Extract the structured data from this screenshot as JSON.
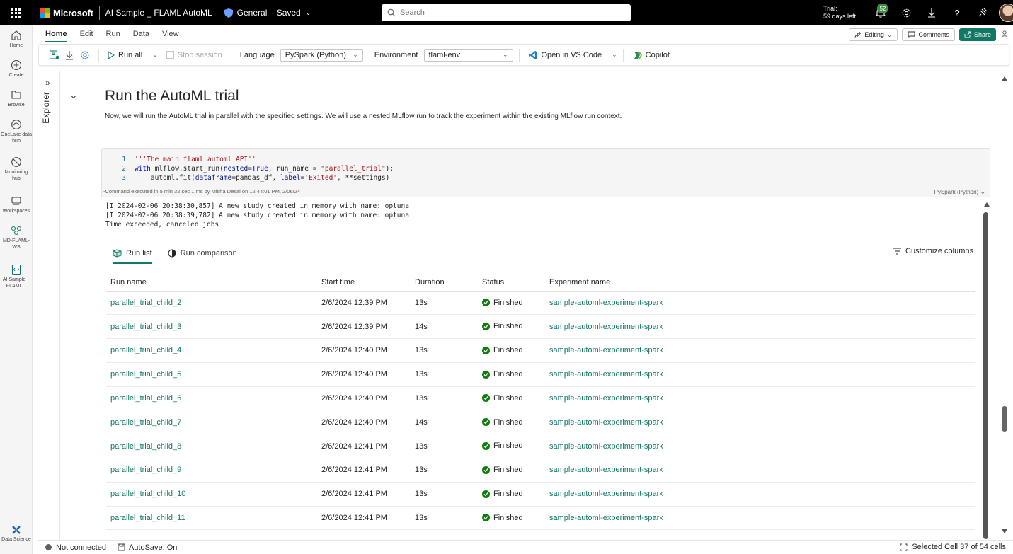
{
  "topbar": {
    "brand": "Microsoft",
    "notebook_name": "AI Sample _ FLAML AutoML",
    "workspace": "General",
    "save_state": "· Saved",
    "search_placeholder": "Search",
    "trial_line1": "Trial:",
    "trial_line2": "59 days left",
    "notification_count": "52"
  },
  "rail": {
    "items": [
      {
        "label": "Home",
        "icon": "home-icon"
      },
      {
        "label": "Create",
        "icon": "plus-circle-icon"
      },
      {
        "label": "Browse",
        "icon": "folder-icon"
      },
      {
        "label": "OneLake data hub",
        "icon": "onelake-icon"
      },
      {
        "label": "Monitoring hub",
        "icon": "monitoring-icon"
      },
      {
        "label": "Workspaces",
        "icon": "workspaces-icon"
      },
      {
        "label": "MD-FLAML-WS",
        "icon": "workspace-group-icon"
      },
      {
        "label": "AI Sample _ FLAML...",
        "icon": "notebook-icon"
      },
      {
        "label": "Data Science",
        "icon": "data-science-icon"
      }
    ]
  },
  "menu": {
    "tabs": [
      "Home",
      "Edit",
      "Run",
      "Data",
      "View"
    ],
    "editing_label": "Editing",
    "comments_label": "Comments",
    "share_label": "Share"
  },
  "toolbar": {
    "run_all": "Run all",
    "stop_session": "Stop session",
    "language_label": "Language",
    "language_value": "PySpark (Python)",
    "environment_label": "Environment",
    "environment_value": "flaml-env",
    "open_vscode": "Open in VS Code",
    "copilot": "Copilot"
  },
  "explorer": {
    "label": "Explorer"
  },
  "cell": {
    "title": "Run the AutoML trial",
    "description": "Now, we will run the AutoML trial in parallel with the specified settings. We will use a nested MLflow run to track the experiment within the existing MLflow run context.",
    "code": {
      "line_numbers": [
        "1",
        "2",
        "3"
      ]
    },
    "exec_info": "-Command executed in 5 min 32 sec 1 ms by Misha Desai on 12:44:01 PM, 2/06/24",
    "language_tag": "PySpark (Python)"
  },
  "output": {
    "log_lines": [
      "[I 2024-02-06 20:38:30,857] A new study created in memory with name: optuna",
      "[I 2024-02-06 20:38:39,782] A new study created in memory with name: optuna",
      "Time exceeded, canceled jobs"
    ],
    "tabs": {
      "run_list": "Run list",
      "run_comparison": "Run comparison"
    },
    "customize_columns": "Customize columns",
    "table": {
      "columns": [
        "Run name",
        "Start time",
        "Duration",
        "Status",
        "Experiment name"
      ],
      "rows": [
        [
          "parallel_trial_child_2",
          "2/6/2024 12:39 PM",
          "13s",
          "Finished",
          "sample-automl-experiment-spark"
        ],
        [
          "parallel_trial_child_3",
          "2/6/2024 12:39 PM",
          "14s",
          "Finished",
          "sample-automl-experiment-spark"
        ],
        [
          "parallel_trial_child_4",
          "2/6/2024 12:40 PM",
          "13s",
          "Finished",
          "sample-automl-experiment-spark"
        ],
        [
          "parallel_trial_child_5",
          "2/6/2024 12:40 PM",
          "13s",
          "Finished",
          "sample-automl-experiment-spark"
        ],
        [
          "parallel_trial_child_6",
          "2/6/2024 12:40 PM",
          "13s",
          "Finished",
          "sample-automl-experiment-spark"
        ],
        [
          "parallel_trial_child_7",
          "2/6/2024 12:40 PM",
          "14s",
          "Finished",
          "sample-automl-experiment-spark"
        ],
        [
          "parallel_trial_child_8",
          "2/6/2024 12:41 PM",
          "13s",
          "Finished",
          "sample-automl-experiment-spark"
        ],
        [
          "parallel_trial_child_9",
          "2/6/2024 12:41 PM",
          "13s",
          "Finished",
          "sample-automl-experiment-spark"
        ],
        [
          "parallel_trial_child_10",
          "2/6/2024 12:41 PM",
          "13s",
          "Finished",
          "sample-automl-experiment-spark"
        ],
        [
          "parallel_trial_child_11",
          "2/6/2024 12:41 PM",
          "13s",
          "Finished",
          "sample-automl-experiment-spark"
        ]
      ]
    }
  },
  "statusbar": {
    "connection": "Not connected",
    "autosave": "AutoSave: On",
    "selection": "Selected Cell 37 of 54 cells"
  },
  "colors": {
    "accent": "#117865",
    "status_success": "#107c10",
    "topbar_bg": "#000000"
  }
}
